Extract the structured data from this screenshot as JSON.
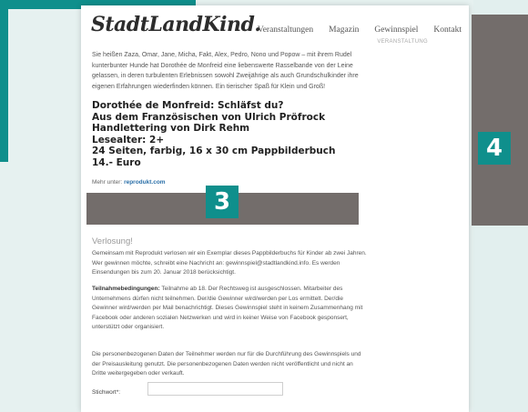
{
  "site": {
    "logo_part1": "Stadt",
    "logo_part2": "Land",
    "logo_part3": "Kind."
  },
  "nav": {
    "items": [
      "Veranstaltungen",
      "Magazin",
      "Gewinnspiel",
      "Kontakt"
    ],
    "sub_label": "VERANSTALTUNG"
  },
  "intro": "Sie heißen Zaza, Omar, Jane, Micha, Fakt, Alex, Pedro, Nono und Popow – mit ihrem Rudel kunterbunter Hunde hat Dorothée de Monfreid eine liebenswerte Rasselbande von der Leine gelassen, in deren turbulenten Erlebnissen sowohl Zweijährige als auch Grundschulkinder ihre eigenen Erfahrungen wiederfinden können. Ein tierischer Spaß für Klein und Groß!",
  "book": {
    "line1": "Dorothée de Monfreid: Schläfst du?",
    "line2": "Aus dem Französischen von Ulrich Pröfrock",
    "line3": "Handlettering von Dirk Rehm",
    "line4": "Lesealter: 2+",
    "line5": "24 Seiten, farbig, 16 x 30 cm Pappbilderbuch",
    "line6": "14.- Euro"
  },
  "more": {
    "label": "Mehr unter:",
    "link": "reprodukt.com"
  },
  "raffle": {
    "heading": "Verlosung!",
    "para1": "Gemeinsam mit Reprodukt verlosen wir ein Exemplar dieses Pappbilderbuchs für Kinder ab zwei Jahren. Wer gewinnen möchte, schreibt eine Nachricht an: gewinnspiel@stadtlandkind.info. Es werden Einsendungen bis zum 20. Januar 2018 berücksichtigt.",
    "para2_bold": "Teilnahmebedingungen:",
    "para2": " Teilnahme ab 18. Der Rechtsweg ist ausgeschlossen. Mitarbeiter des Unternehmens dürfen nicht teilnehmen. Der/die Gewinner wird/werden per Los ermittelt. Der/die Gewinner wird/werden per Mail benachrichtigt. Dieses Gewinnspiel steht in keinem Zusammenhang mit Facebook oder anderen sozialen Netzwerken und wird in keiner Weise von Facebook gesponsert, unterstützt oder organisiert.",
    "para3": "Die personenbezogenen Daten der Teilnehmer werden nur für die Durchführung des Gewinnspiels und der Preisausleitung genutzt. Die personenbezogenen Daten werden nicht veröffentlicht und nicht an Dritte weitergegeben oder verkauft.",
    "field_label": "Stichwort*:",
    "field_value": ""
  },
  "badges": {
    "three": "3",
    "four": "4"
  },
  "colors": {
    "teal": "#0f8f8c",
    "overlay_gray": "#736d6b",
    "link_blue": "#2a6fa8"
  }
}
